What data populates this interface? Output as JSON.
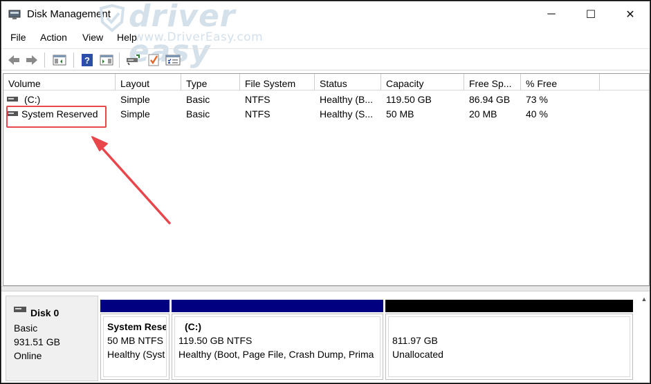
{
  "window": {
    "title": "Disk Management",
    "controls": {
      "minimize": "─",
      "maximize": "☐",
      "close": "✕"
    }
  },
  "watermark": {
    "brand": "driver easy",
    "url": "www.DriverEasy.com"
  },
  "menu": [
    "File",
    "Action",
    "View",
    "Help"
  ],
  "toolbar": {
    "icons": [
      "back-icon",
      "forward-icon",
      "show-hide-console-tree-icon",
      "help-icon",
      "show-action-pane-icon",
      "connect-icon",
      "check-icon",
      "properties-icon"
    ]
  },
  "volume_list": {
    "columns": [
      "Volume",
      "Layout",
      "Type",
      "File System",
      "Status",
      "Capacity",
      "Free Sp...",
      "% Free"
    ],
    "rows": [
      {
        "volume": "(C:)",
        "layout": "Simple",
        "type": "Basic",
        "file_system": "NTFS",
        "status": "Healthy (B...",
        "capacity": "119.50 GB",
        "free_space": "86.94 GB",
        "percent_free": "73 %"
      },
      {
        "volume": "System Reserved",
        "layout": "Simple",
        "type": "Basic",
        "file_system": "NTFS",
        "status": "Healthy (S...",
        "capacity": "50 MB",
        "free_space": "20 MB",
        "percent_free": "40 %"
      }
    ]
  },
  "disk": {
    "name": "Disk 0",
    "type": "Basic",
    "size": "931.51 GB",
    "state": "Online",
    "partitions": [
      {
        "title": "System Rese",
        "size_fs": "50 MB NTFS",
        "status": "Healthy (Syst",
        "bar_color": "#000080"
      },
      {
        "title": "(C:)",
        "size_fs": "119.50 GB NTFS",
        "status": "Healthy (Boot, Page File, Crash Dump, Prima",
        "bar_color": "#000080"
      },
      {
        "title": "",
        "size_fs": "811.97 GB",
        "status": "Unallocated",
        "bar_color": "#000000"
      }
    ]
  },
  "colors": {
    "annotation": "#e8464b",
    "primary_partition": "#000080",
    "unallocated": "#000000"
  }
}
